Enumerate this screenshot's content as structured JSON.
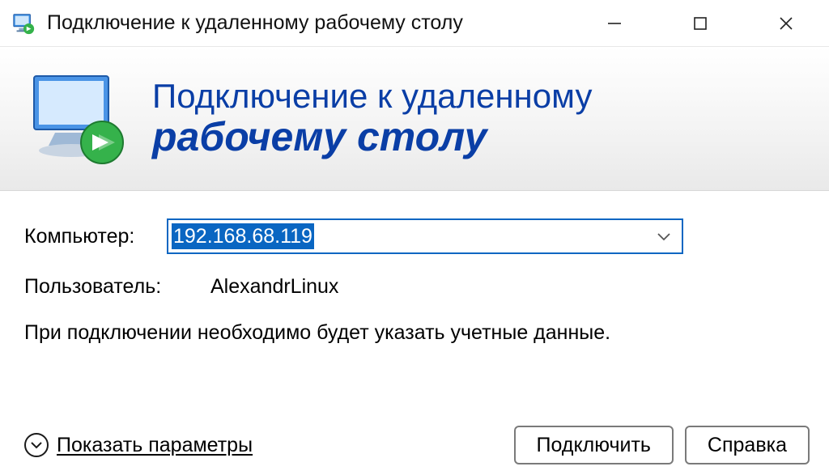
{
  "titlebar": {
    "title": "Подключение к удаленному рабочему столу"
  },
  "banner": {
    "line1": "Подключение к удаленному",
    "line2": "рабочему столу"
  },
  "form": {
    "computer_label": "Компьютер:",
    "computer_value": "192.168.68.119",
    "user_label": "Пользователь:",
    "user_value": "AlexandrLinux",
    "hint": "При подключении необходимо будет указать учетные данные."
  },
  "footer": {
    "show_params": "Показать параметры",
    "connect": "Подключить",
    "help": "Справка"
  }
}
